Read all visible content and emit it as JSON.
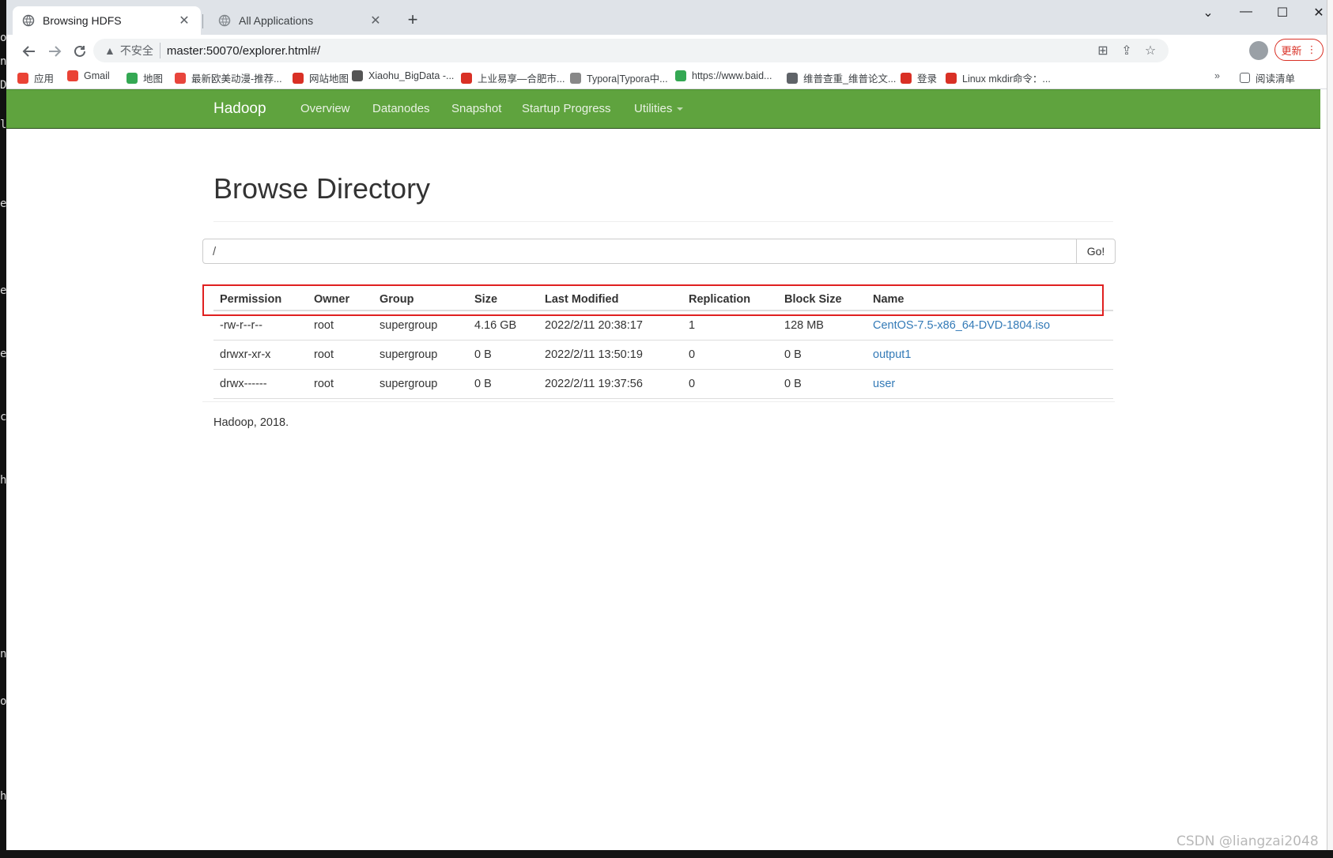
{
  "browser": {
    "tabs": [
      {
        "title": "Browsing HDFS",
        "active": true
      },
      {
        "title": "All Applications",
        "active": false
      }
    ],
    "address": {
      "security_label": "不安全",
      "url": "master:50070/explorer.html#/"
    },
    "update_button": "更新",
    "bookmarks": [
      {
        "label": "应用",
        "icon": "apps-grid-icon",
        "color": "#ea4335"
      },
      {
        "label": "Gmail",
        "icon": "gmail-icon",
        "color": "#ea4335"
      },
      {
        "label": "地图",
        "icon": "maps-icon",
        "color": "#34a853"
      },
      {
        "label": "最新欧美动漫-推荐...",
        "icon": "play-icon",
        "color": "#e8453c"
      },
      {
        "label": "网站地图",
        "icon": "c-logo-icon",
        "color": "#d93025"
      },
      {
        "label": "Xiaohu_BigData -...",
        "icon": "xiaohu-icon",
        "color": "#555555"
      },
      {
        "label": "上业易享—合肥市...",
        "icon": "s-logo-icon",
        "color": "#d93025"
      },
      {
        "label": "Typora|Typora中...",
        "icon": "typora-icon",
        "color": "#888888"
      },
      {
        "label": "https://www.baid...",
        "icon": "baidu-icon",
        "color": "#34a853"
      },
      {
        "label": "维普查重_维普论文...",
        "icon": "globe-icon",
        "color": "#5f6368"
      },
      {
        "label": "登录",
        "icon": "login-icon",
        "color": "#d93025"
      },
      {
        "label": "Linux mkdir命令：...",
        "icon": "c-logo-icon",
        "color": "#d93025"
      }
    ],
    "reading_list": "阅读清单"
  },
  "navbar": {
    "brand": "Hadoop",
    "links": [
      "Overview",
      "Datanodes",
      "Snapshot",
      "Startup Progress",
      "Utilities"
    ],
    "color": "#5fa33e"
  },
  "page": {
    "title": "Browse Directory",
    "path_value": "/",
    "go_label": "Go!"
  },
  "table": {
    "headers": [
      "Permission",
      "Owner",
      "Group",
      "Size",
      "Last Modified",
      "Replication",
      "Block Size",
      "Name"
    ],
    "rows": [
      [
        "-rw-r--r--",
        "root",
        "supergroup",
        "4.16 GB",
        "2022/2/11 20:38:17",
        "1",
        "128 MB",
        "CentOS-7.5-x86_64-DVD-1804.iso"
      ],
      [
        "drwxr-xr-x",
        "root",
        "supergroup",
        "0 B",
        "2022/2/11 13:50:19",
        "0",
        "0 B",
        "output1"
      ],
      [
        "drwx------",
        "root",
        "supergroup",
        "0 B",
        "2022/2/11 19:37:56",
        "0",
        "0 B",
        "user"
      ]
    ]
  },
  "footer": "Hadoop, 2018.",
  "watermark": "CSDN @liangzai2048"
}
